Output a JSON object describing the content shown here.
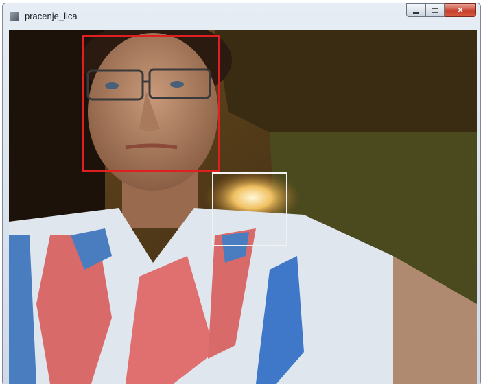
{
  "window": {
    "title": "pracenje_lica",
    "icon": "app-icon",
    "buttons": {
      "minimize": "minimize-icon",
      "maximize": "maximize-icon",
      "close": "close-icon",
      "close_glyph": "✕"
    }
  },
  "colors": {
    "detection_box": "#e02020",
    "tracking_box": "#f2f2f2",
    "close_button": "#c7402c"
  }
}
